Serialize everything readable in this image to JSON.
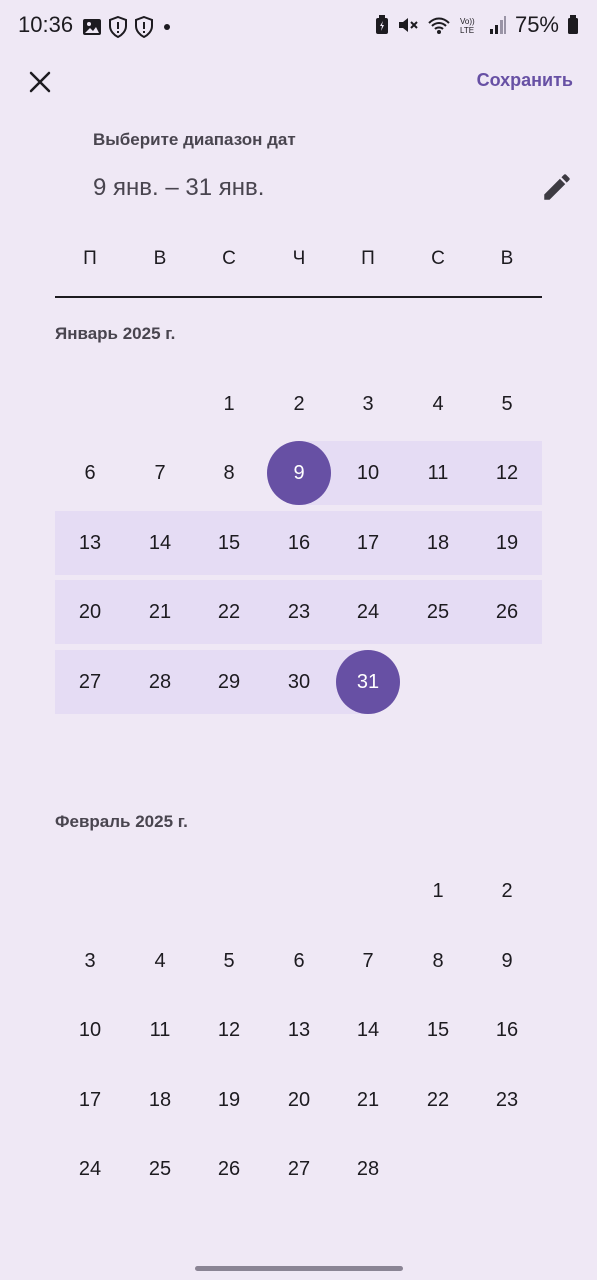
{
  "status_bar": {
    "time": "10:36",
    "battery": "75%",
    "left_icons": [
      "image-icon",
      "shield-icon",
      "shield-icon",
      "dot-icon"
    ],
    "right_icons": [
      "battery-saver-icon",
      "mute-icon",
      "wifi-icon",
      "volte-icon",
      "signal-icon",
      "battery-icon"
    ]
  },
  "header": {
    "close_icon": "close-icon",
    "save_label": "Сохранить",
    "subtitle": "Выберите диапазон дат",
    "range": "9 янв. – 31 янв.",
    "edit_icon": "pencil-icon"
  },
  "weekdays": [
    "П",
    "В",
    "С",
    "Ч",
    "П",
    "С",
    "В"
  ],
  "months": [
    {
      "label": "Январь 2025 г.",
      "weeks": [
        [
          "",
          "",
          "1",
          "2",
          "3",
          "4",
          "5"
        ],
        [
          "6",
          "7",
          "8",
          "9",
          "10",
          "11",
          "12"
        ],
        [
          "13",
          "14",
          "15",
          "16",
          "17",
          "18",
          "19"
        ],
        [
          "20",
          "21",
          "22",
          "23",
          "24",
          "25",
          "26"
        ],
        [
          "27",
          "28",
          "29",
          "30",
          "31",
          "",
          ""
        ]
      ]
    },
    {
      "label": "Февраль 2025 г.",
      "weeks": [
        [
          "",
          "",
          "",
          "",
          "",
          "1",
          "2"
        ],
        [
          "3",
          "4",
          "5",
          "6",
          "7",
          "8",
          "9"
        ],
        [
          "10",
          "11",
          "12",
          "13",
          "14",
          "15",
          "16"
        ],
        [
          "17",
          "18",
          "19",
          "20",
          "21",
          "22",
          "23"
        ],
        [
          "24",
          "25",
          "26",
          "27",
          "28",
          "",
          ""
        ]
      ]
    }
  ],
  "selection": {
    "start_day": "9",
    "end_day": "31",
    "month": "Январь 2025 г."
  },
  "colors": {
    "accent": "#6750a4",
    "range_band": "#e5dcf4",
    "background": "#efe8f5"
  }
}
